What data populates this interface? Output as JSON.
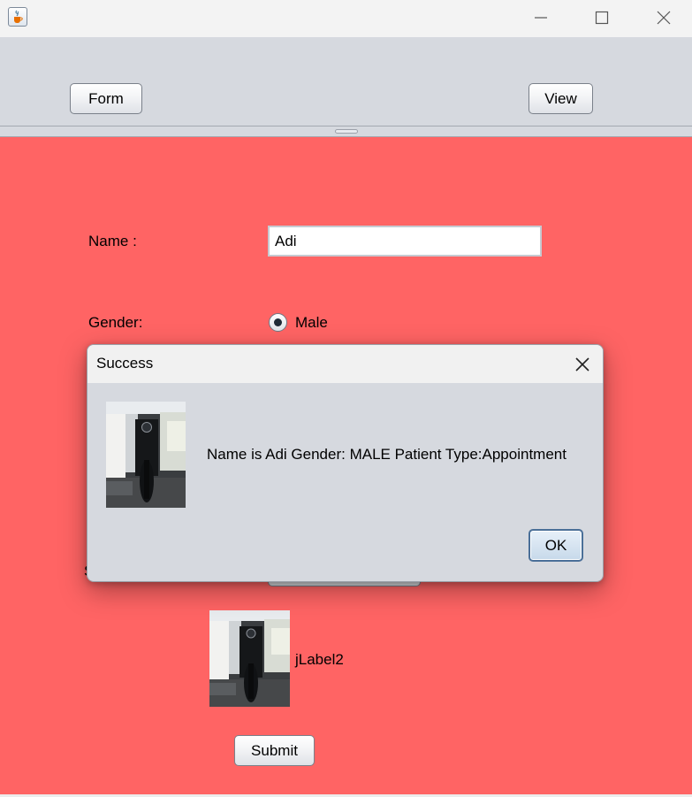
{
  "window": {
    "icon": "java-cup-icon",
    "controls": [
      "minimize-icon",
      "maximize-icon",
      "close-icon"
    ]
  },
  "top_panel": {
    "form_button": "Form",
    "view_button": "View"
  },
  "form": {
    "name_label": "Name :",
    "name_value": "Adi",
    "gender_label": "Gender:",
    "gender_option": "Male",
    "gender_selected": true,
    "image_label": "jLabel2",
    "submit_button": "Submit",
    "background_color": "#ff6464"
  },
  "dialog": {
    "title": "Success",
    "message": "Name is Adi Gender: MALE Patient Type:Appointment",
    "ok_button": "OK",
    "close_icon": "close-icon"
  }
}
